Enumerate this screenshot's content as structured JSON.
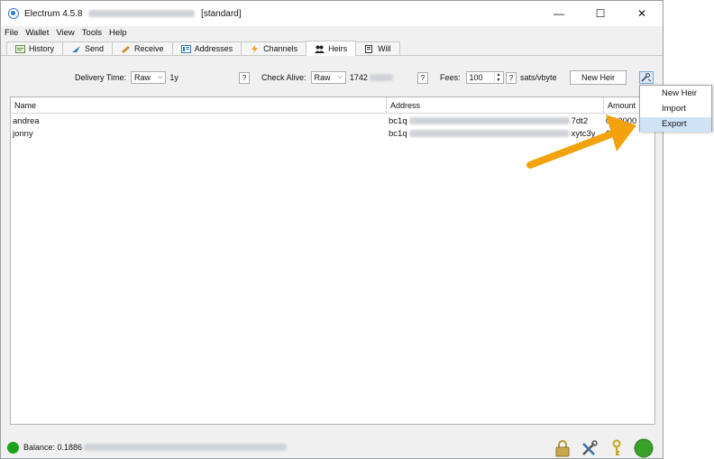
{
  "window": {
    "title_app": "Electrum 4.5.8",
    "title_mode": "[standard]",
    "controls": [
      "—",
      "☐",
      "✕"
    ]
  },
  "menu": [
    "File",
    "Wallet",
    "View",
    "Tools",
    "Help"
  ],
  "tabs": [
    {
      "label": "History",
      "icon": "history-icon"
    },
    {
      "label": "Send",
      "icon": "send-icon"
    },
    {
      "label": "Receive",
      "icon": "receive-icon"
    },
    {
      "label": "Addresses",
      "icon": "addresses-icon"
    },
    {
      "label": "Channels",
      "icon": "lightning-icon"
    },
    {
      "label": "Heirs",
      "icon": "people-icon",
      "active": true
    },
    {
      "label": "Will",
      "icon": "will-icon"
    }
  ],
  "toolbar": {
    "delivery_label": "Delivery Time:",
    "delivery_combo": "Raw",
    "delivery_value": "1y",
    "help_q": "?",
    "check_alive_label": "Check Alive:",
    "check_alive_combo": "Raw",
    "check_alive_value": "1742",
    "fees_label": "Fees:",
    "fees_value": "100",
    "fees_unit": "sats/vbyte",
    "new_heir_button": "New Heir"
  },
  "table": {
    "headers": [
      "Name",
      "Address",
      "Amount"
    ],
    "rows": [
      {
        "name": "andrea",
        "address_prefix": "bc1q",
        "address_suffix": "7dt2",
        "amount": "0.02000"
      },
      {
        "name": "jonny",
        "address_prefix": "bc1q",
        "address_suffix": "xytc3y",
        "amount": "0.0"
      }
    ]
  },
  "dropdown": {
    "items": [
      "New Heir",
      "Import",
      "Export"
    ],
    "selected": "Export"
  },
  "status": {
    "balance_label": "Balance: 0.1886",
    "connection_color": "#1ea21e"
  },
  "colors": {
    "annotation_arrow": "#f2a20c",
    "selection": "#cfe3f7",
    "accent": "#2d77c4"
  }
}
